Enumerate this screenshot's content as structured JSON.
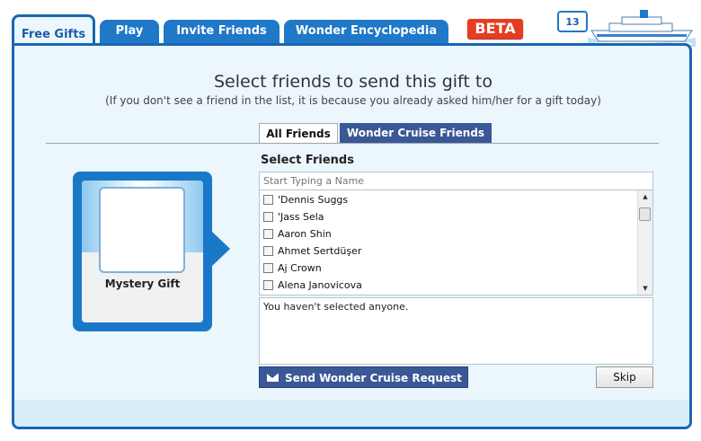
{
  "tabs": [
    {
      "label": "Free Gifts",
      "active": true
    },
    {
      "label": "Play"
    },
    {
      "label": "Invite Friends"
    },
    {
      "label": "Wonder Encyclopedia"
    }
  ],
  "beta_badge": "BETA",
  "mail": {
    "count": "13",
    "icon": "envelope-icon"
  },
  "ship_icon": "cruise-ship-icon",
  "heading": "Select friends to send this gift to",
  "subheading": "(If you don't see a friend in the list, it is because you already asked him/her for a gift today)",
  "filter_tabs": {
    "all": "All Friends",
    "wonder": "Wonder Cruise Friends"
  },
  "gift": {
    "label": "Mystery Gift"
  },
  "select": {
    "title": "Select Friends",
    "search_placeholder": "Start Typing a Name",
    "friends": [
      "'Dennis Suggs",
      "'Jass Sela",
      "Aaron Shin",
      "Ahmet Sertdüşer",
      "Aj Crown",
      "Alena Janovicova"
    ],
    "selected_text": "You haven't selected anyone."
  },
  "buttons": {
    "send": "Send Wonder Cruise Request",
    "skip": "Skip"
  },
  "colors": {
    "tab_blue": "#1f78c8",
    "panel_border": "#1a66b3",
    "panel_bg": "#ecf6fd",
    "button_navy": "#3a5796",
    "beta_red": "#e53c22"
  }
}
